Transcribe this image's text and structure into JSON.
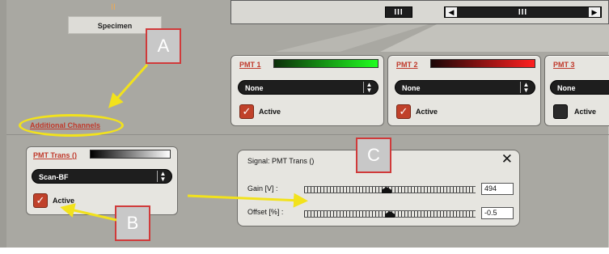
{
  "specimen": {
    "label": "Specimen",
    "mark": "II"
  },
  "scroll": {
    "left_mid": "III",
    "right_mid": "III"
  },
  "additional_channels": "Additional Channels",
  "pmt_channels": [
    {
      "title": "PMT 1",
      "select": "None",
      "active_label": "Active",
      "active": true,
      "gradient": [
        "#0c2e0a",
        "#20ff20"
      ]
    },
    {
      "title": "PMT 2",
      "select": "None",
      "active_label": "Active",
      "active": true,
      "gradient": [
        "#1a0606",
        "#ff2020"
      ]
    },
    {
      "title": "PMT 3",
      "select": "None",
      "active_label": "Active",
      "active": false,
      "gradient": [
        "#06061a",
        "#2030ff"
      ]
    }
  ],
  "trans": {
    "title": "PMT Trans ()",
    "select": "Scan-BF",
    "active_label": "Active",
    "active": true
  },
  "signal_dialog": {
    "title": "Signal: PMT Trans ()",
    "close": "✕",
    "gain_label": "Gain [V] :",
    "gain_value": "494",
    "gain_position": 0.48,
    "offset_label": "Offset [%] :",
    "offset_value": "-0.5",
    "offset_position": 0.5
  },
  "callouts": {
    "a": "A",
    "b": "B",
    "c": "C"
  },
  "colors": {
    "accent": "#c0392b",
    "annotation_yellow": "#f2e21c",
    "annotation_red": "#d03a3a"
  }
}
